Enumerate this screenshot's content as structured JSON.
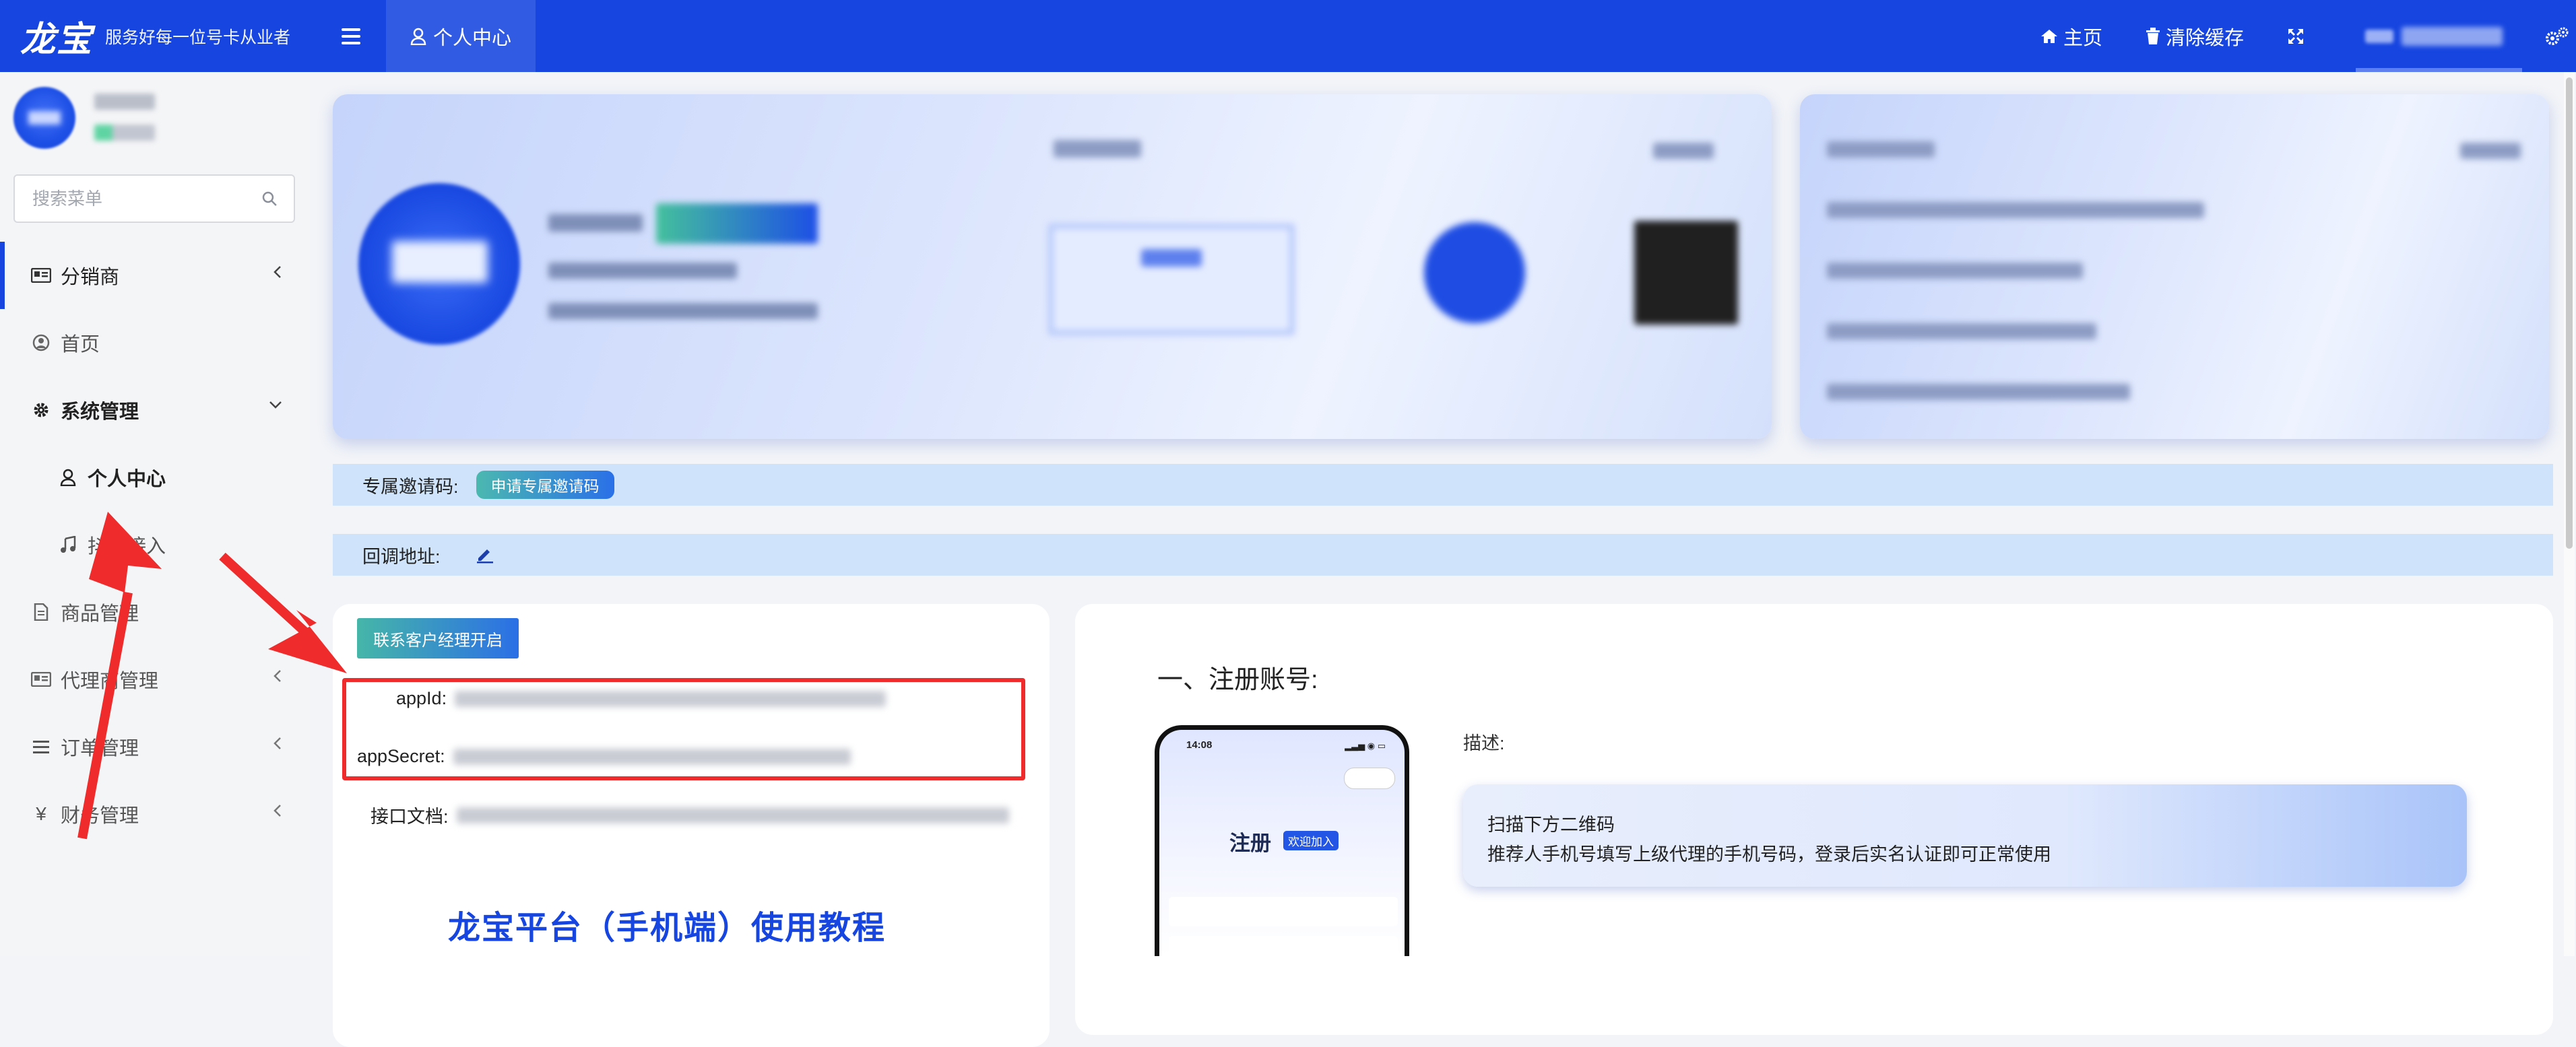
{
  "header": {
    "logo": "龙宝",
    "slogan": "服务好每一位号卡从业者",
    "current_tab": "个人中心",
    "home_label": "主页",
    "clear_cache_label": "清除缓存"
  },
  "sidebar": {
    "search_placeholder": "搜索菜单",
    "items": [
      {
        "label": "分销商",
        "icon": "id-card-icon"
      },
      {
        "label": "首页",
        "icon": "user-circle-icon"
      },
      {
        "label": "系统管理",
        "icon": "gear-icon"
      },
      {
        "label": "个人中心",
        "icon": "user-icon"
      },
      {
        "label": "抖音接入",
        "icon": "music-note-icon"
      },
      {
        "label": "商品管理",
        "icon": "document-icon"
      },
      {
        "label": "代理商管理",
        "icon": "id-card-icon"
      },
      {
        "label": "订单管理",
        "icon": "list-icon"
      },
      {
        "label": "财务管理",
        "icon": "yen-icon"
      }
    ]
  },
  "invite": {
    "label": "专属邀请码:",
    "button": "申请专属邀请码"
  },
  "callback": {
    "label": "回调地址:"
  },
  "api": {
    "open_button": "联系客户经理开启",
    "appid_label": "appId:",
    "appsecret_label": "appSecret:",
    "docs_label": "接口文档:"
  },
  "tutorial": {
    "title": "龙宝平台（手机端）使用教程"
  },
  "register": {
    "step_title": "一、注册账号:",
    "desc_label": "描述:",
    "desc_line1": "扫描下方二维码",
    "desc_line2": "推荐人手机号填写上级代理的手机号码，登录后实名认证即可正常使用"
  },
  "phone": {
    "time": "14:08",
    "title": "注册",
    "badge": "欢迎加入"
  },
  "colors": {
    "brand": "#1645e0",
    "strip": "#cfe4fb",
    "annotation_red": "#ef2b2b"
  }
}
